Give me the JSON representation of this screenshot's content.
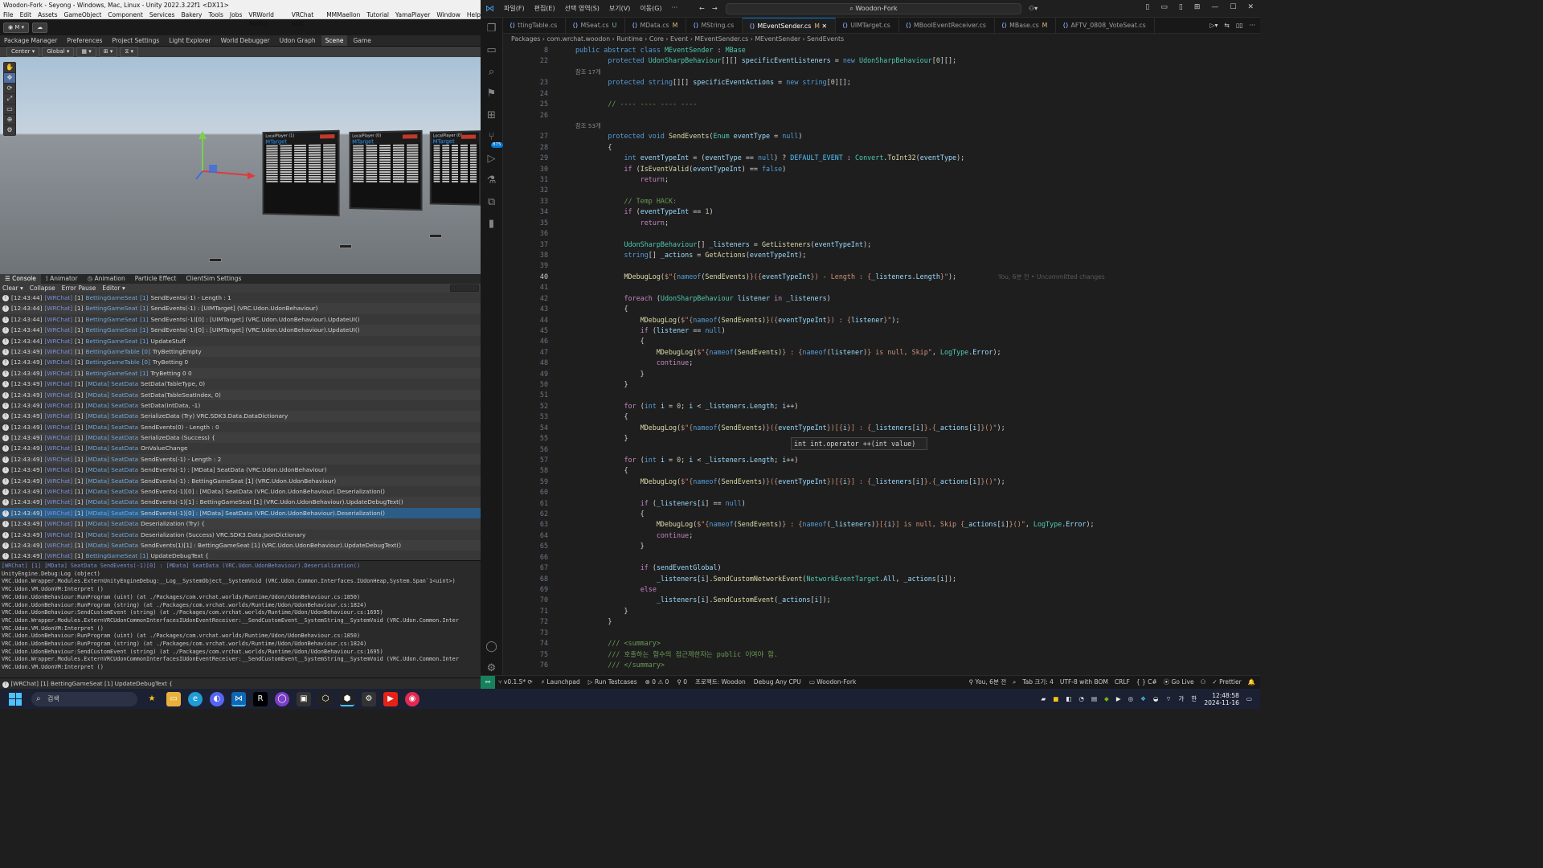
{
  "unity": {
    "title": "Woodon-Fork - Seyong - Windows, Mac, Linux - Unity 2022.3.22f1 <DX11>",
    "menu": [
      "File",
      "Edit",
      "Assets",
      "GameObject",
      "Component",
      "Services",
      "Bakery",
      "Tools",
      "Jobs",
      "VRWorld Toolkit",
      "VRChat SDK",
      "MMMaellon",
      "Tutorial",
      "YamaPlayer",
      "Window",
      "Help"
    ],
    "account": "M",
    "editor_tabs": [
      "Package Manager",
      "Preferences",
      "Project Settings",
      "Light Explorer",
      "World Debugger",
      "Udon Graph",
      "Scene",
      "Game"
    ],
    "scene_toolbar": {
      "pivot": "Center",
      "space": "Global"
    },
    "scene_boards": [
      {
        "player": "LocalPlayer (1)",
        "target": "MTarget",
        "state": "StartTarget"
      },
      {
        "player": "LocalPlayer (0)",
        "target": "MTarget",
        "state": "StartTarget"
      },
      {
        "player": "LocalPlayer (0)",
        "target": "MTarget",
        "state": "StartTarget"
      }
    ],
    "bottom_tabs": [
      "Console",
      "Animator",
      "Animation",
      "Particle Effect",
      "ClientSim Settings"
    ],
    "console_toolbar": [
      "Clear",
      "Collapse",
      "Error Pause",
      "Editor"
    ],
    "logs": [
      {
        "time": "[12:43:44]",
        "tag": "[WRChat]",
        "idx": "[1]",
        "cls": "BettingGameSeat",
        "c2": "[1]",
        "msg": "SendEvents(-1) - Length : 1"
      },
      {
        "time": "[12:43:44]",
        "tag": "[WRChat]",
        "idx": "[1]",
        "cls": "BettingGameSeat",
        "c2": "[1]",
        "msg": "SendEvents(-1) : [UIMTarget] (VRC.Udon.UdonBehaviour)"
      },
      {
        "time": "[12:43:44]",
        "tag": "[WRChat]",
        "idx": "[1]",
        "cls": "BettingGameSeat",
        "c2": "[1]",
        "msg": "SendEvents(-1)[0] : [UIMTarget] (VRC.Udon.UdonBehaviour).UpdateUI()"
      },
      {
        "time": "[12:43:44]",
        "tag": "[WRChat]",
        "idx": "[1]",
        "cls": "BettingGameSeat",
        "c2": "[1]",
        "msg": "SendEvents(-1)[0] : [UIMTarget] (VRC.Udon.UdonBehaviour).UpdateUI()"
      },
      {
        "time": "[12:43:44]",
        "tag": "[WRChat]",
        "idx": "[1]",
        "cls": "BettingGameSeat",
        "c2": "[1]",
        "msg": "UpdateStuff"
      },
      {
        "time": "[12:43:49]",
        "tag": "[WRChat]",
        "idx": "[1]",
        "cls": "BettingGameTable",
        "c2": "[0]",
        "msg": "TryBettingEmpty"
      },
      {
        "time": "[12:43:49]",
        "tag": "[WRChat]",
        "idx": "[1]",
        "cls": "BettingGameTable",
        "c2": "[0]",
        "msg": "TryBetting 0"
      },
      {
        "time": "[12:43:49]",
        "tag": "[WRChat]",
        "idx": "[1]",
        "cls": "BettingGameSeat",
        "c2": "[1]",
        "msg": "TryBetting 0 0"
      },
      {
        "time": "[12:43:49]",
        "tag": "[WRChat]",
        "idx": "[1]",
        "cls": "[MData] SeatData",
        "c2": "",
        "msg": "SetData(TableType, 0)"
      },
      {
        "time": "[12:43:49]",
        "tag": "[WRChat]",
        "idx": "[1]",
        "cls": "[MData] SeatData",
        "c2": "",
        "msg": "SetData(TableSeatIndex, 0)"
      },
      {
        "time": "[12:43:49]",
        "tag": "[WRChat]",
        "idx": "[1]",
        "cls": "[MData] SeatData",
        "c2": "",
        "msg": "SetData(IntData, -1)"
      },
      {
        "time": "[12:43:49]",
        "tag": "[WRChat]",
        "idx": "[1]",
        "cls": "[MData] SeatData",
        "c2": "",
        "msg": "SerializeData (Try) VRC.SDK3.Data.DataDictionary"
      },
      {
        "time": "[12:43:49]",
        "tag": "[WRChat]",
        "idx": "[1]",
        "cls": "[MData] SeatData",
        "c2": "",
        "msg": "SendEvents(0) - Length : 0"
      },
      {
        "time": "[12:43:49]",
        "tag": "[WRChat]",
        "idx": "[1]",
        "cls": "[MData] SeatData",
        "c2": "",
        "msg": "SerializeData (Success) {"
      },
      {
        "time": "[12:43:49]",
        "tag": "[WRChat]",
        "idx": "[1]",
        "cls": "[MData] SeatData",
        "c2": "",
        "msg": "OnValueChange"
      },
      {
        "time": "[12:43:49]",
        "tag": "[WRChat]",
        "idx": "[1]",
        "cls": "[MData] SeatData",
        "c2": "",
        "msg": "SendEvents(-1) - Length : 2"
      },
      {
        "time": "[12:43:49]",
        "tag": "[WRChat]",
        "idx": "[1]",
        "cls": "[MData] SeatData",
        "c2": "",
        "msg": "SendEvents(-1) : [MData] SeatData (VRC.Udon.UdonBehaviour)"
      },
      {
        "time": "[12:43:49]",
        "tag": "[WRChat]",
        "idx": "[1]",
        "cls": "[MData] SeatData",
        "c2": "",
        "msg": "SendEvents(-1) : BettingGameSeat [1] (VRC.Udon.UdonBehaviour)"
      },
      {
        "time": "[12:43:49]",
        "tag": "[WRChat]",
        "idx": "[1]",
        "cls": "[MData] SeatData",
        "c2": "",
        "msg": "SendEvents(-1)[0] : [MData] SeatData (VRC.Udon.UdonBehaviour).Deserialization()"
      },
      {
        "time": "[12:43:49]",
        "tag": "[WRChat]",
        "idx": "[1]",
        "cls": "[MData] SeatData",
        "c2": "",
        "msg": "SendEvents(-1)[1] : BettingGameSeat [1] (VRC.Udon.UdonBehaviour).UpdateDebugText()"
      },
      {
        "time": "[12:43:49]",
        "tag": "[WRChat]",
        "idx": "[1]",
        "cls": "[MData] SeatData",
        "c2": "",
        "msg": "SendEvents(-1)[0] : [MData] SeatData (VRC.Udon.UdonBehaviour).Deserialization()"
      },
      {
        "time": "[12:43:49]",
        "tag": "[WRChat]",
        "idx": "[1]",
        "cls": "[MData] SeatData",
        "c2": "",
        "msg": "Deserialization (Try) {"
      },
      {
        "time": "[12:43:49]",
        "tag": "[WRChat]",
        "idx": "[1]",
        "cls": "[MData] SeatData",
        "c2": "",
        "msg": "Deserialization (Success) VRC.SDK3.Data.JsonDictionary"
      },
      {
        "time": "[12:43:49]",
        "tag": "[WRChat]",
        "idx": "[1]",
        "cls": "[MData] SeatData",
        "c2": "",
        "msg": "SendEvents(1)[1] : BettingGameSeat [1] (VRC.Udon.UdonBehaviour).UpdateDebugText()"
      },
      {
        "time": "[12:43:49]",
        "tag": "[WRChat]",
        "idx": "[1]",
        "cls": "BettingGameSeat",
        "c2": "[1]",
        "msg": "UpdateDebugText {"
      }
    ],
    "selected_log": 20,
    "detail_lines": [
      "[WRChat] [1] [MData] SeatData SendEvents(-1)[0] : [MData] SeatData (VRC.Udon.UdonBehaviour).Deserialization()",
      "UnityEngine.Debug:Log (object)",
      "VRC.Udon.Wrapper.Modules.ExternUnityEngineDebug:__Log__SystemObject__SystemVoid (VRC.Udon.Common.Interfaces.IUdonHeap,System.Span`1<uint>)",
      "VRC.Udon.VM.UdonVM:Interpret ()",
      "VRC.Udon.UdonBehaviour:RunProgram (uint) (at ./Packages/com.vrchat.worlds/Runtime/Udon/UdonBehaviour.cs:1850)",
      "VRC.Udon.UdonBehaviour:RunProgram (string) (at ./Packages/com.vrchat.worlds/Runtime/Udon/UdonBehaviour.cs:1824)",
      "VRC.Udon.UdonBehaviour:SendCustomEvent (string) (at ./Packages/com.vrchat.worlds/Runtime/Udon/UdonBehaviour.cs:1695)",
      "VRC.Udon.Wrapper.Modules.ExternVRCUdonCommonInterfacesIUdonEventReceiver:__SendCustomEvent__SystemString__SystemVoid (VRC.Udon.Common.Inter",
      "VRC.Udon.VM.UdonVM:Interpret ()",
      "VRC.Udon.UdonBehaviour:RunProgram (uint) (at ./Packages/com.vrchat.worlds/Runtime/Udon/UdonBehaviour.cs:1850)",
      "VRC.Udon.UdonBehaviour:RunProgram (string) (at ./Packages/com.vrchat.worlds/Runtime/Udon/UdonBehaviour.cs:1824)",
      "VRC.Udon.UdonBehaviour:SendCustomEvent (string) (at ./Packages/com.vrchat.worlds/Runtime/Udon/UdonBehaviour.cs:1695)",
      "VRC.Udon.Wrapper.Modules.ExternVRCUdonCommonInterfacesIUdonEventReceiver:__SendCustomEvent__SystemString__SystemVoid (VRC.Udon.Common.Inter",
      "VRC.Udon.VM.UdonVM:Interpret ()"
    ],
    "status_line": "[WRChat] [1] BettingGameSeat [1] UpdateDebugText {"
  },
  "vscode": {
    "menu": [
      "파일(F)",
      "편집(E)",
      "선택 영역(S)",
      "보기(V)",
      "이동(G)",
      "···"
    ],
    "command_center": "Woodon-Fork",
    "tabs": [
      {
        "name": "ttingTable.cs",
        "status": ""
      },
      {
        "name": "MSeat.cs",
        "status": "U"
      },
      {
        "name": "MData.cs",
        "status": "M"
      },
      {
        "name": "MString.cs",
        "status": ""
      },
      {
        "name": "MEventSender.cs",
        "status": "M",
        "active": true
      },
      {
        "name": "UIMTarget.cs",
        "status": ""
      },
      {
        "name": "MBoolEventReceiver.cs",
        "status": ""
      },
      {
        "name": "MBase.cs",
        "status": "M"
      },
      {
        "name": "AFTV_0808_VoteSeat.cs",
        "status": ""
      }
    ],
    "breadcrumb": [
      "Packages",
      "com.wrchat.woodon",
      "Runtime",
      "Core",
      "Event",
      "MEventSender.cs",
      "MEventSender",
      "SendEvents"
    ],
    "scm_badge": "875",
    "hover_text": "int int.operator ++(int value)",
    "blame_text": "You, 6분 전 • Uncommitted changes",
    "status": {
      "branch": "v0.1.5*",
      "launchpad": "Launchpad",
      "run_tests": "Run Testcases",
      "problems": "⊗ 0 ⚠ 0",
      "ports": "0",
      "project": "프로젝트: Woodon",
      "debug": "Debug Any CPU",
      "folder": "Woodon-Fork",
      "blame": "You, 6분 전",
      "tab_size": "Tab 크기: 4",
      "encoding": "UTF-8 with BOM",
      "eol": "CRLF",
      "lang": "{ } C#",
      "golive": "Go Live",
      "prettier": "Prettier"
    }
  },
  "taskbar": {
    "search_placeholder": "검색",
    "time": "12:48:58",
    "date": "2024-11-16",
    "ime": "가",
    "ime2": "한"
  }
}
